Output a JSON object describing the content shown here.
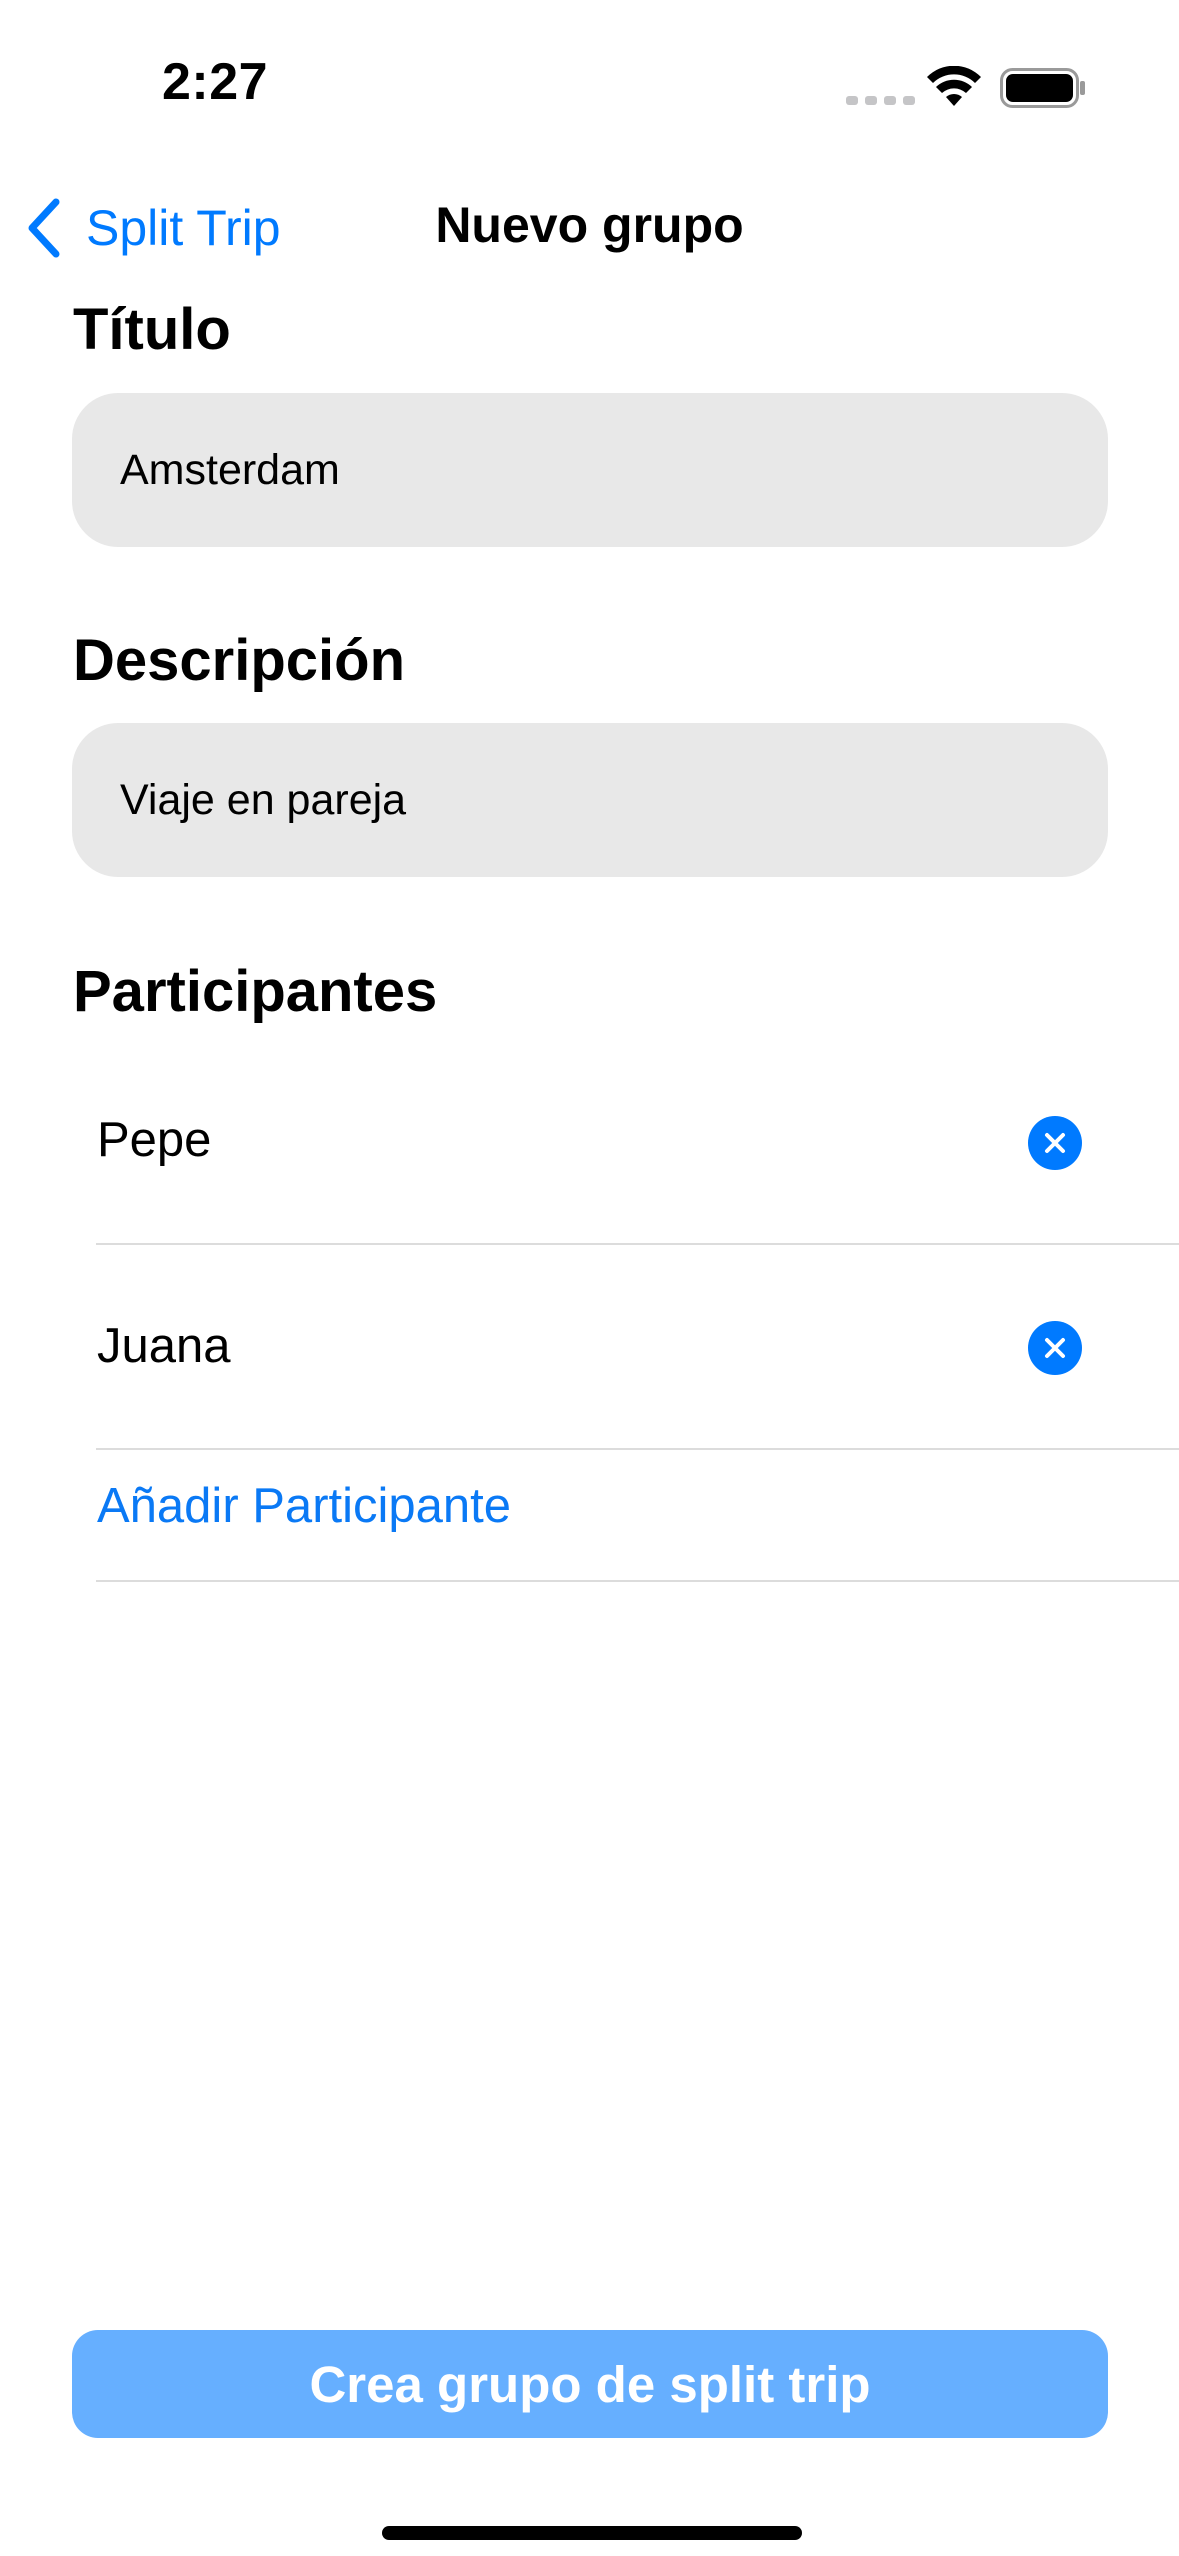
{
  "status_bar": {
    "time": "2:27"
  },
  "nav": {
    "back_label": "Split Trip",
    "title": "Nuevo grupo"
  },
  "form": {
    "title_heading": "Título",
    "title_value": "Amsterdam",
    "description_heading": "Descripción",
    "description_value": "Viaje en pareja",
    "participants_heading": "Participantes",
    "participants": [
      {
        "name": "Pepe"
      },
      {
        "name": "Juana"
      }
    ],
    "add_participant_label": "Añadir Participante"
  },
  "actions": {
    "create_label": "Crea grupo de split trip"
  },
  "colors": {
    "accent": "#007AFF",
    "button_disabled": "#66AFFF",
    "field_background": "#E8E8E8"
  }
}
